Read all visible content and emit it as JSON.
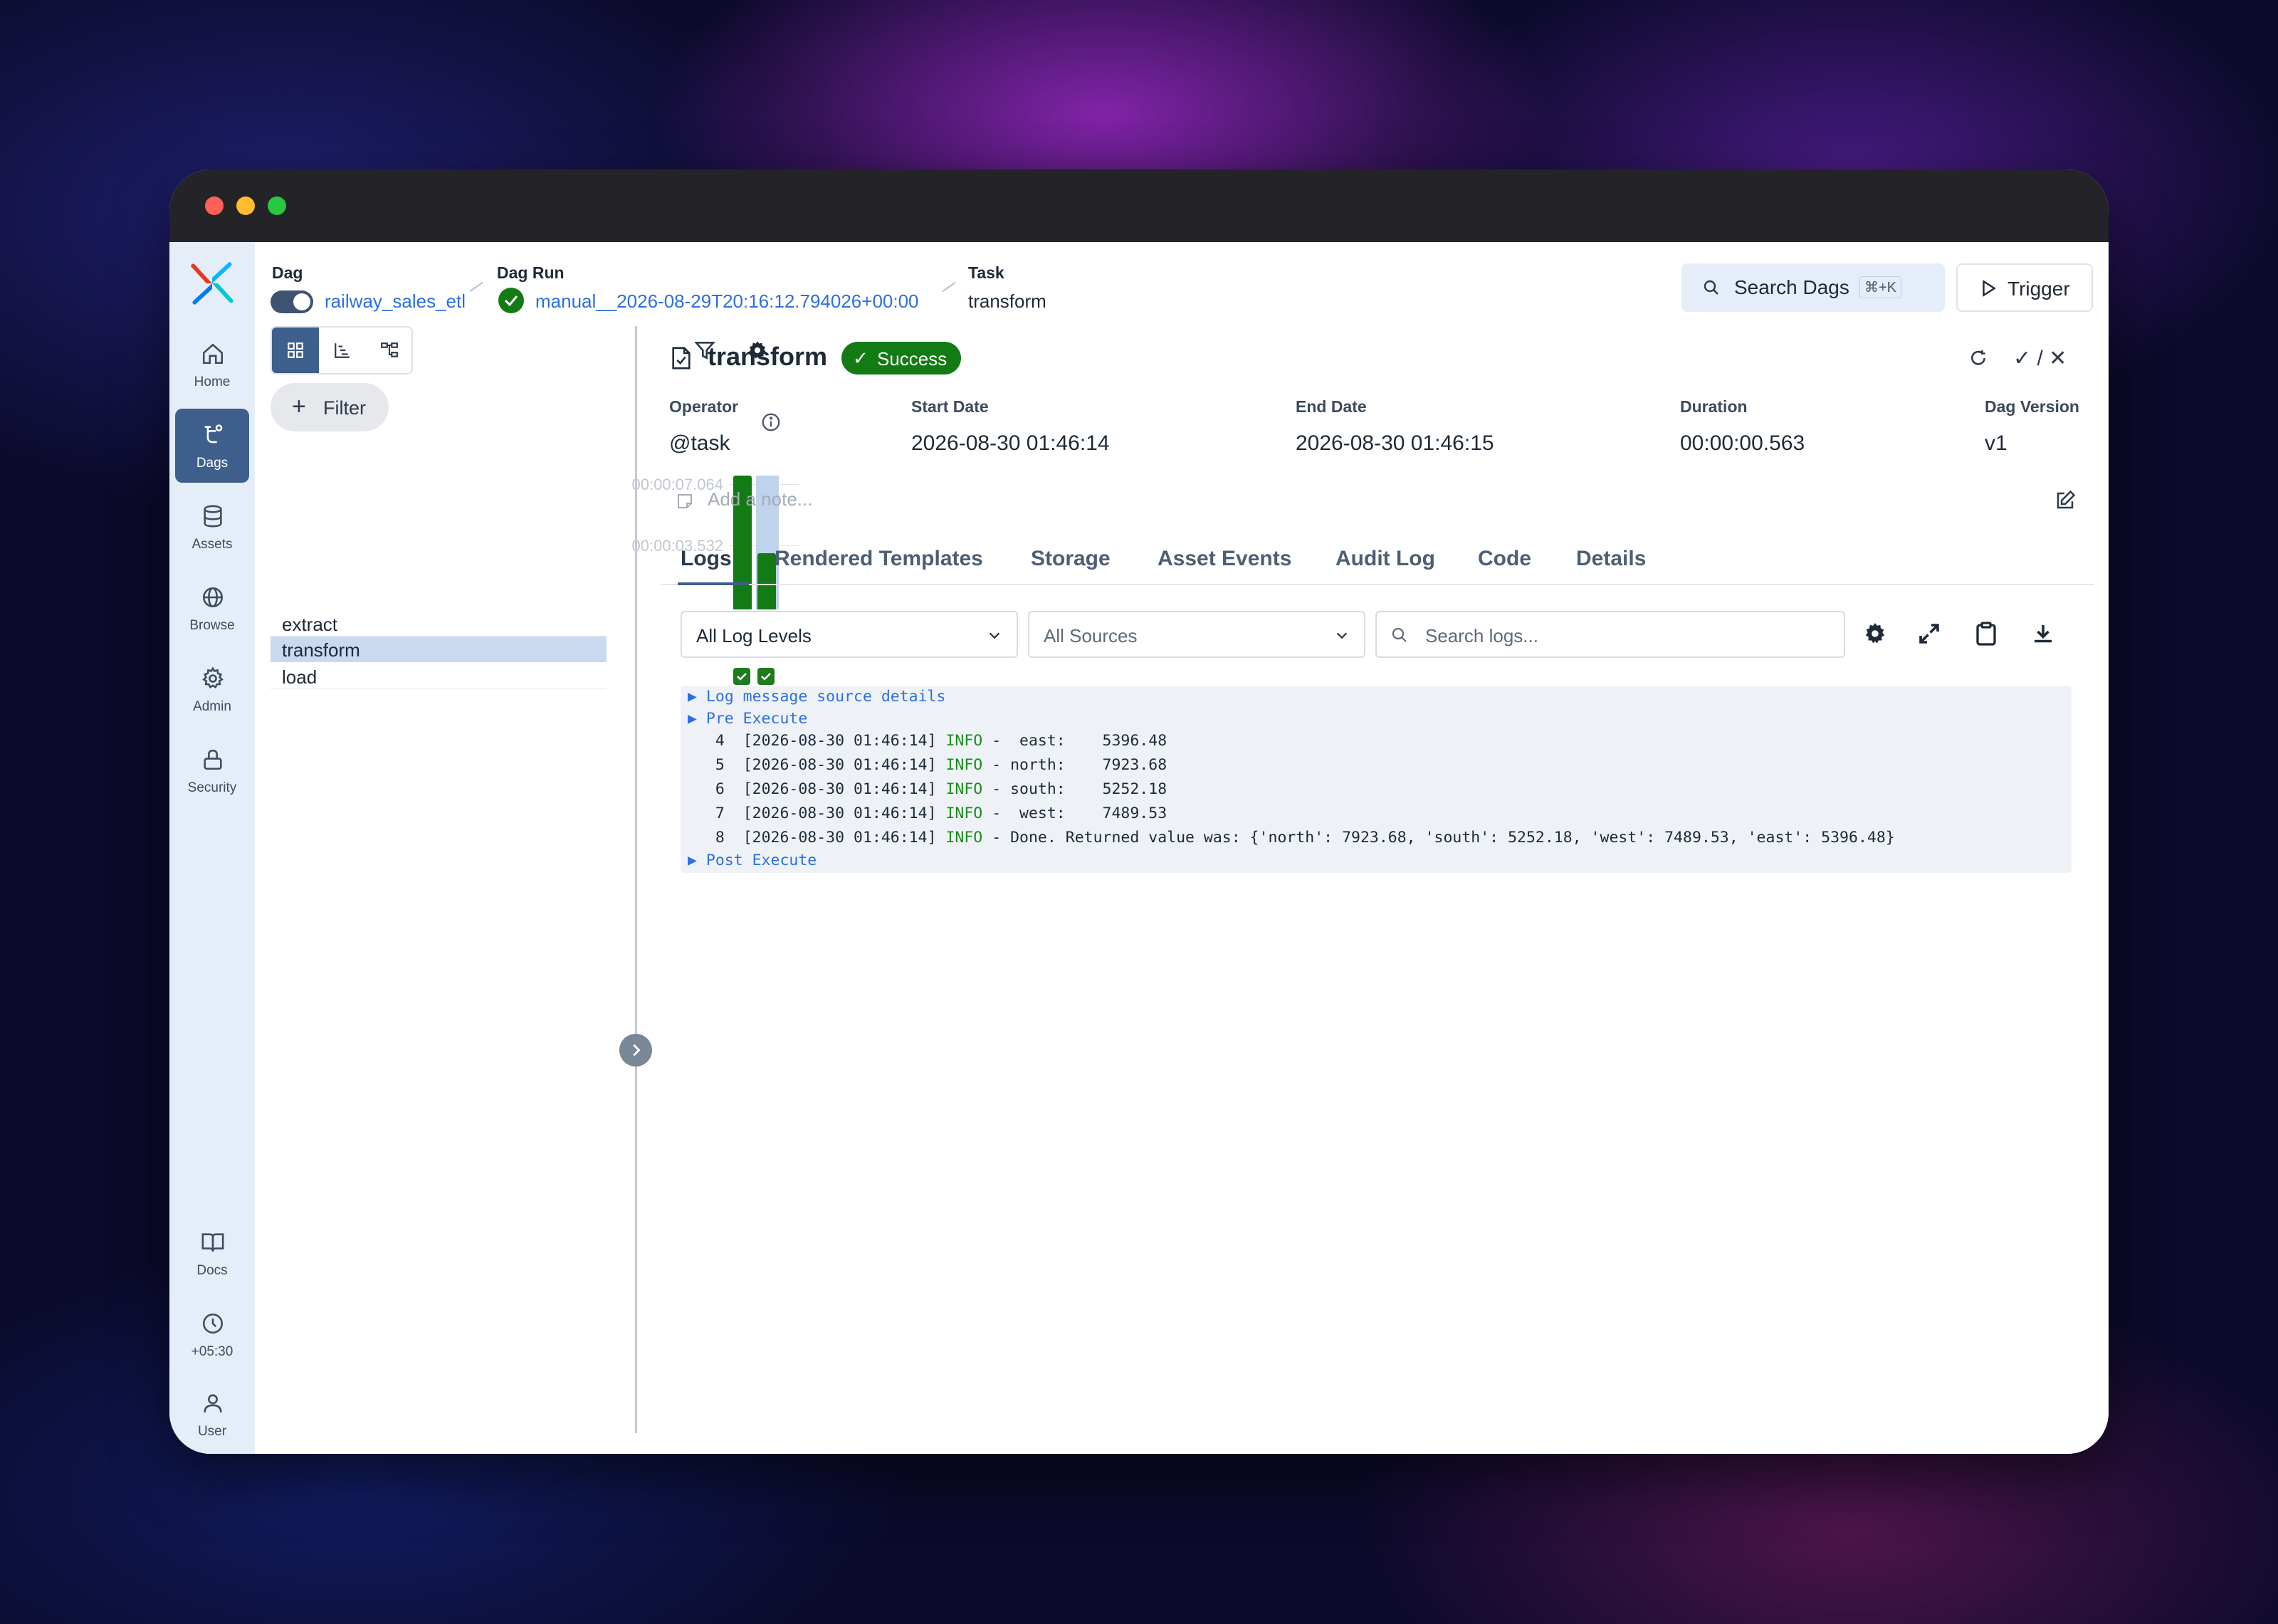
{
  "nav": {
    "items": [
      {
        "label": "Home",
        "icon": "home-icon"
      },
      {
        "label": "Dags",
        "icon": "dags-icon",
        "active": true
      },
      {
        "label": "Assets",
        "icon": "database-icon"
      },
      {
        "label": "Browse",
        "icon": "globe-icon"
      },
      {
        "label": "Admin",
        "icon": "gear-icon"
      },
      {
        "label": "Security",
        "icon": "lock-icon"
      },
      {
        "label": "Docs",
        "icon": "book-icon"
      },
      {
        "label": "+05:30",
        "icon": "clock-icon"
      },
      {
        "label": "User",
        "icon": "user-icon"
      }
    ]
  },
  "breadcrumb": {
    "dag_label": "Dag",
    "dag_value": "railway_sales_etl",
    "run_label": "Dag Run",
    "run_value": "manual__2026-08-29T20:16:12.794026+00:00",
    "task_label": "Task",
    "task_value": "transform"
  },
  "header": {
    "search_label": "Search Dags",
    "search_shortcut": "⌘+K",
    "trigger_label": "Trigger"
  },
  "grid": {
    "filter_label": "Filter",
    "durations": [
      "00:00:07.064",
      "00:00:03.532"
    ],
    "run_bars": [
      {
        "state": "success",
        "fraction": 1.0
      },
      {
        "state": "success",
        "fraction": 0.42,
        "selected": true
      }
    ],
    "tasks": [
      {
        "name": "extract",
        "states": [
          "success",
          "success"
        ]
      },
      {
        "name": "transform",
        "states": [
          "success",
          "success"
        ],
        "selected": true
      },
      {
        "name": "load",
        "states": [
          "success",
          "success"
        ]
      }
    ]
  },
  "task": {
    "title": "transform",
    "state": "Success",
    "action_mark": "✓ / ✕",
    "meta": {
      "operator_label": "Operator",
      "operator": "@task",
      "start_label": "Start Date",
      "start": "2026-08-30 01:46:14",
      "end_label": "End Date",
      "end": "2026-08-30 01:46:15",
      "duration_label": "Duration",
      "duration": "00:00:00.563",
      "version_label": "Dag Version",
      "version": "v1"
    },
    "note_placeholder": "Add a note..."
  },
  "tabs": [
    "Logs",
    "Rendered Templates",
    "Storage",
    "Asset Events",
    "Audit Log",
    "Code",
    "Details"
  ],
  "logs": {
    "level_select": "All Log Levels",
    "source_select": "All Sources",
    "search_placeholder": "Search logs...",
    "section_source": "Log message source details",
    "section_pre": "Pre Execute",
    "section_post": "Post Execute",
    "lines": [
      {
        "num": "4",
        "ts": "[2026-08-30 01:46:14]",
        "level": "INFO",
        "msg": " -  east:    5396.48"
      },
      {
        "num": "5",
        "ts": "[2026-08-30 01:46:14]",
        "level": "INFO",
        "msg": " - north:    7923.68"
      },
      {
        "num": "6",
        "ts": "[2026-08-30 01:46:14]",
        "level": "INFO",
        "msg": " - south:    5252.18"
      },
      {
        "num": "7",
        "ts": "[2026-08-30 01:46:14]",
        "level": "INFO",
        "msg": " -  west:    7489.53"
      },
      {
        "num": "8",
        "ts": "[2026-08-30 01:46:14]",
        "level": "INFO",
        "msg": " - Done. Returned value was: {'north': 7923.68, 'south': 5252.18, 'west': 7489.53, 'east': 5396.48}"
      }
    ]
  },
  "colors": {
    "success": "#137b13",
    "nav_active": "#3e5e8c",
    "link": "#2b6fe3"
  }
}
